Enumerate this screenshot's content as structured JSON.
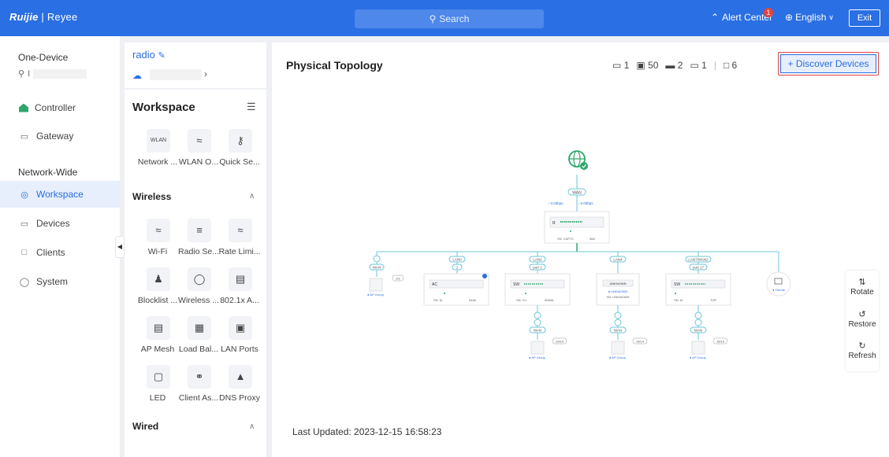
{
  "brand": {
    "logo": "Ruijie",
    "sep": " | ",
    "name": "Reyee"
  },
  "header": {
    "search_label": "Search",
    "alert_label": "Alert Center",
    "alert_count": "1",
    "language": "English",
    "exit_label": "Exit"
  },
  "nav": {
    "one_device_label": "One-Device",
    "device_prefix": "I",
    "items": [
      {
        "label": "Controller"
      },
      {
        "label": "Gateway"
      }
    ],
    "network_wide_label": "Network-Wide",
    "wide_items": [
      {
        "label": "Workspace"
      },
      {
        "label": "Devices"
      },
      {
        "label": "Clients"
      },
      {
        "label": "System"
      }
    ]
  },
  "workspace": {
    "network_name": "radio",
    "title": "Workspace",
    "top_tiles": [
      {
        "label": "Network ..."
      },
      {
        "label": "WLAN O..."
      },
      {
        "label": "Quick Se..."
      }
    ],
    "wireless_title": "Wireless",
    "wireless_tiles": [
      {
        "label": "Wi-Fi"
      },
      {
        "label": "Radio Se..."
      },
      {
        "label": "Rate Limi..."
      },
      {
        "label": "Blocklist ..."
      },
      {
        "label": "Wireless ..."
      },
      {
        "label": "802.1x A..."
      },
      {
        "label": "AP Mesh"
      },
      {
        "label": "Load Bal..."
      },
      {
        "label": "LAN Ports"
      },
      {
        "label": "LED"
      },
      {
        "label": "Client As..."
      },
      {
        "label": "DNS Proxy"
      }
    ],
    "wired_title": "Wired"
  },
  "main": {
    "title": "Physical Topology",
    "stats": [
      {
        "icon": "gateway-icon",
        "value": "1"
      },
      {
        "icon": "ap-icon",
        "value": "50"
      },
      {
        "icon": "switch-icon",
        "value": "2"
      },
      {
        "icon": "router-icon",
        "value": "1"
      },
      {
        "icon": "client-icon",
        "value": "6"
      }
    ],
    "discover_label": "+ Discover Devices",
    "last_updated": "Last Updated: 2023-12-15 16:58:23",
    "tools": [
      {
        "label": "Rotate",
        "icon": "rotate-icon"
      },
      {
        "label": "Restore",
        "icon": "restore-icon"
      },
      {
        "label": "Refresh",
        "icon": "refresh-icon"
      }
    ]
  },
  "topology": {
    "wan": "WAN",
    "up_rate": "↑ 0.00bps",
    "down_rate": "↓ 0.00bps",
    "gateway_sn": "SN: CAP7C",
    "gateway_sn_tail": "368",
    "ports": [
      "LAN0",
      "LAN2",
      "LAN4",
      "LAN7/WAN2"
    ],
    "port_sub": [
      "1",
      "port 1",
      "",
      "port 17"
    ],
    "nodes": [
      {
        "badge": "2/2",
        "label": "● AP Group"
      },
      {
        "model": "AC",
        "sn": "SN: M",
        "sn_tail": "5466"
      },
      {
        "model": "SW",
        "sn": "SN: G1",
        "sn_tail": "5060A"
      },
      {
        "model": "UNKNOWN",
        "status": "● UNKNOWN",
        "sn": "SN: UNKNOWN"
      },
      {
        "model": "SW",
        "sn": "SN: M",
        "sn_tail": "TGP"
      },
      {
        "label": "● Clients"
      }
    ],
    "sub_nodes": [
      {
        "badge": "19/19",
        "label": "● AP Group"
      },
      {
        "badge": "14/14",
        "label": "● AP Group"
      },
      {
        "badge": "15/15",
        "label": "● AP Group"
      }
    ]
  }
}
